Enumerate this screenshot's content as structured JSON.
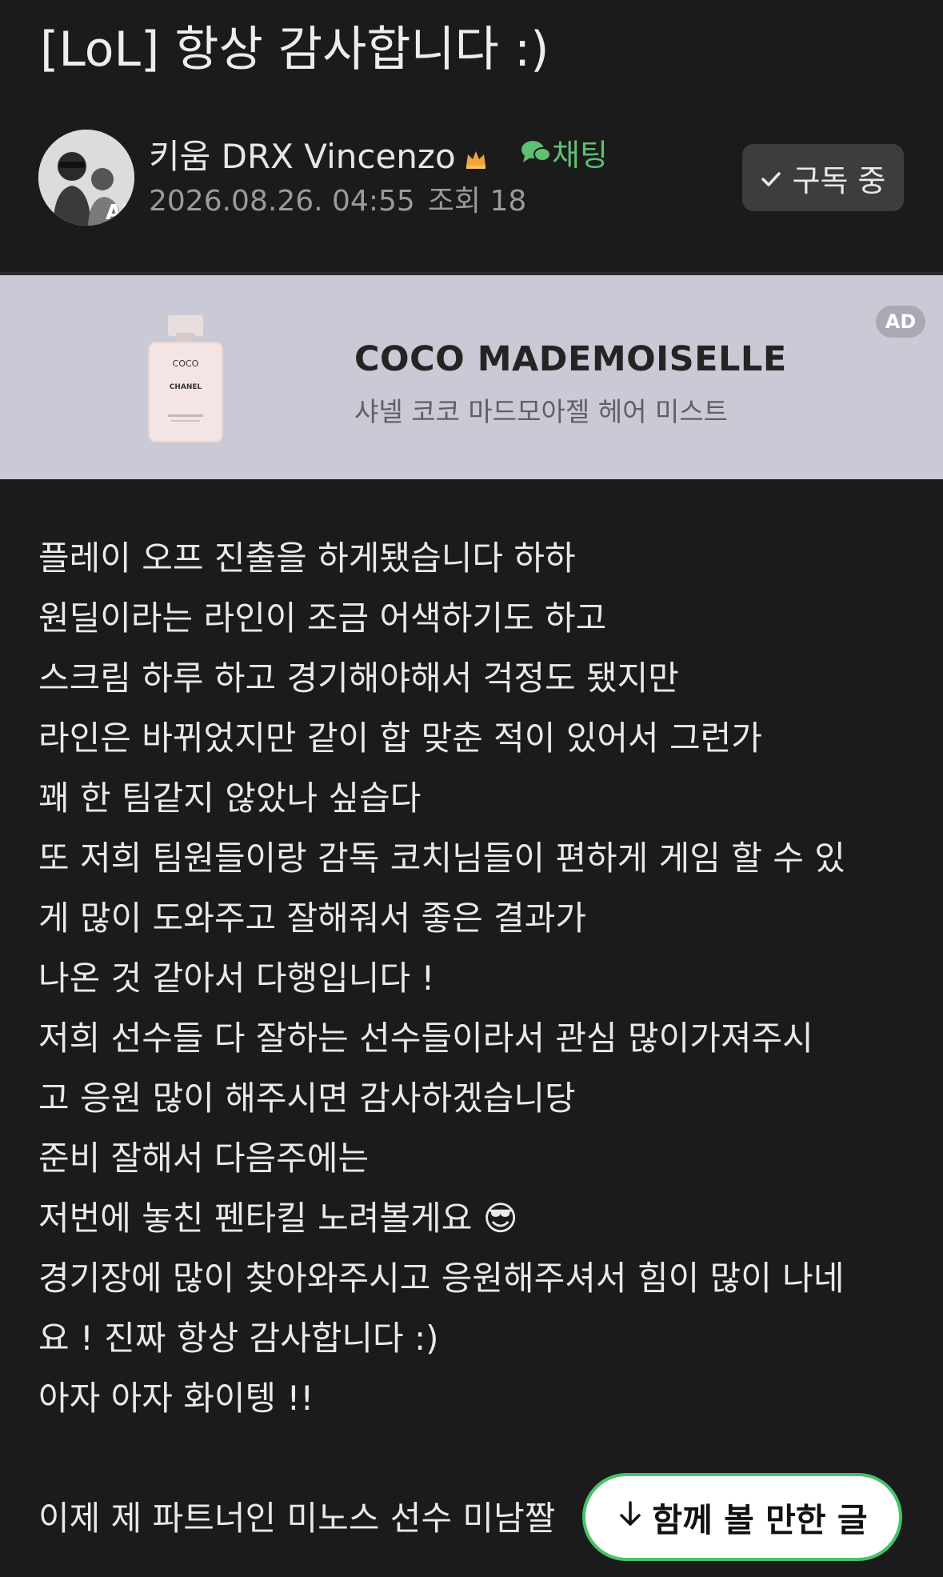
{
  "post": {
    "title": "[LoL] 항상 감사합니다 :)",
    "author": "키움 DRX Vincenzo",
    "chat_label": "채팅",
    "date": "2026.08.26. 04:55",
    "views": "조회 18",
    "subscribe_label": "구독 중"
  },
  "ad": {
    "badge": "AD",
    "title": "COCO MADEMOISELLE",
    "subtitle": "샤넬 코코 마드모아젤 헤어 미스트",
    "bottle_text_1": "COCO",
    "bottle_text_2": "CHANEL"
  },
  "content": {
    "lines": [
      "플레이 오프 진출을 하게됐습니다 하하",
      "원딜이라는 라인이 조금 어색하기도 하고",
      "스크림 하루 하고 경기해야해서 걱정도 됐지만",
      "라인은 바뀌었지만 같이 합 맞춘 적이 있어서 그런가",
      "꽤 한 팀같지 않았나 싶습다",
      "또 저희 팀원들이랑 감독 코치님들이 편하게 게임 할 수 있",
      "게 많이 도와주고 잘해줘서 좋은 결과가",
      "나온 것 같아서 다행입니다 !",
      "저희 선수들 다 잘하는 선수들이라서 관심 많이가져주시",
      "고 응원 많이 해주시면 감사하겠습니당",
      "준비 잘해서 다음주에는",
      "저번에 놓친 펜타킬 노려볼게요 😎",
      "경기장에 많이 찾아와주시고 응원해주셔서 힘이 많이 나네",
      "요 ! 진짜 항상 감사합니다 :)",
      "아자 아자 화이텡 !!"
    ],
    "last_line": "이제 제 파트너인 미노스 선수 미남짤"
  },
  "floating": {
    "label": "함께 볼 만한 글"
  },
  "colors": {
    "background": "#1b1b1b",
    "accent_green": "#47c36a",
    "ad_background": "#c9cad6"
  }
}
